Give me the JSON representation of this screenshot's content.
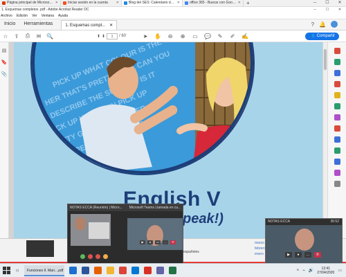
{
  "browser_tabs": [
    {
      "label": "Página principal de Microsoft O...",
      "color": "#d83b01",
      "active": false
    },
    {
      "label": "Iniciar sesión en la cuenta",
      "color": "#f25022",
      "active": false
    },
    {
      "label": "Blog del SES: Calendario de exa...",
      "color": "#1e88e5",
      "active": true
    },
    {
      "label": "office 365 - Buscar con Google",
      "color": "#4285f4",
      "active": false
    }
  ],
  "window_title": "1. Esquemas completos .pdf - Adobe Acrobat Reader DC",
  "menu": [
    "Archivo",
    "Edición",
    "Ver",
    "Ventana",
    "Ayuda"
  ],
  "app_tabs": {
    "home": "Inicio",
    "tools": "Herramientas",
    "document": "1. Esquemas compl..."
  },
  "toolbar": {
    "page_current": "1",
    "page_total": "/ 60",
    "share_label": "Compartir"
  },
  "document": {
    "title": "English V",
    "subtitle_visible": "peak!)",
    "bottom_word": "españoles",
    "notes": [
      "marzo",
      "febrero",
      "enero"
    ]
  },
  "video_call": {
    "window_title": "NOTAS ECCA (Reunión) | Micro...",
    "window_title_2": "Microsoft Teams Llamada en cu...",
    "mini_title": "NOTAS ECCA",
    "mini_time": "36:52"
  },
  "taskbar": {
    "active_item": "Funciones II. Mari....pdf",
    "time": "12:41",
    "date": "27/04/2020"
  },
  "colors": {
    "accent": "#1473e6",
    "title_blue": "#1d3e78",
    "page_bg": "#a8d4ea"
  }
}
